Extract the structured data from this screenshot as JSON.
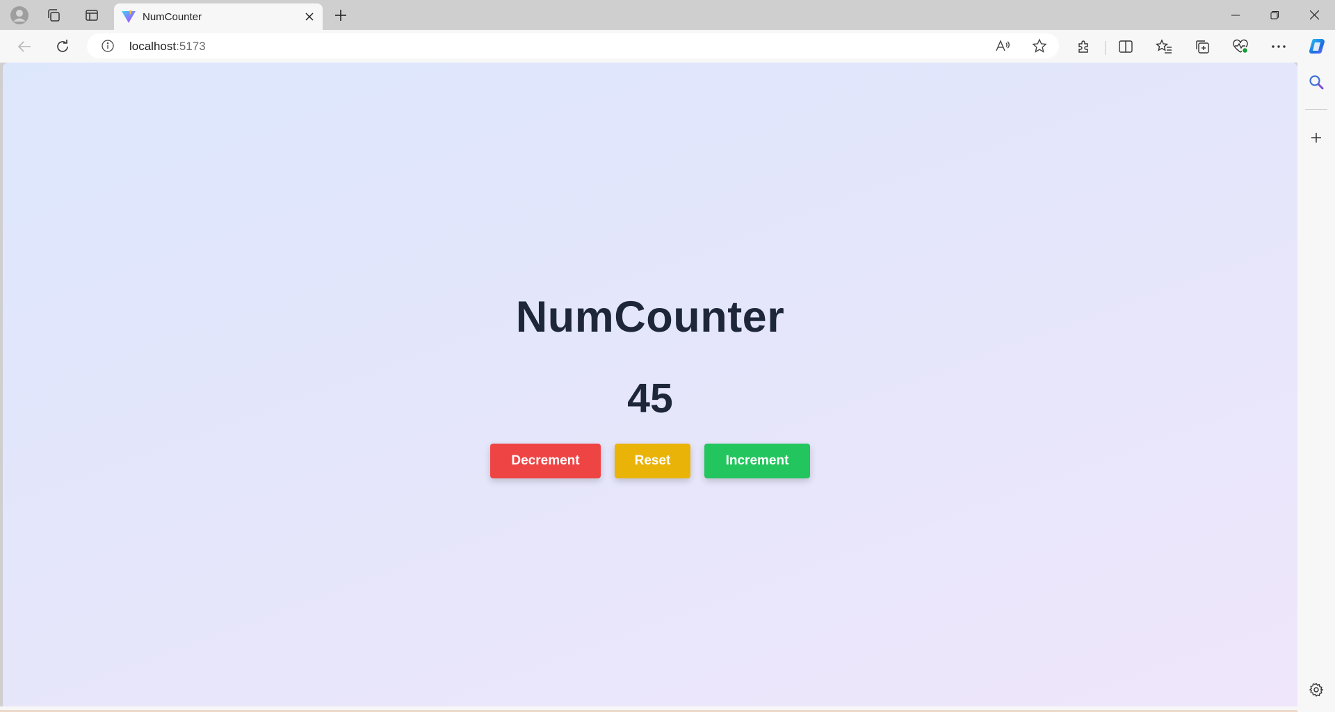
{
  "browser": {
    "tab": {
      "title": "NumCounter",
      "favicon": "vite-logo-icon"
    },
    "address": {
      "host": "localhost",
      "port": ":5173"
    },
    "icons": {
      "profile": "profile-avatar-icon",
      "workspaces": "workspaces-icon",
      "tab_actions": "vertical-tabs-icon",
      "back": "back-arrow-icon",
      "refresh": "refresh-icon",
      "site_info": "info-icon",
      "read_aloud": "read-aloud-icon",
      "favorite": "star-icon",
      "extensions": "extensions-puzzle-icon",
      "split_screen": "split-screen-icon",
      "favorites": "favorites-list-icon",
      "collections": "collections-icon",
      "browser_essentials": "heart-pulse-icon",
      "more": "more-dots-icon",
      "copilot": "copilot-icon",
      "sidebar_search": "search-icon",
      "sidebar_add": "plus-icon",
      "sidebar_settings": "gear-icon"
    }
  },
  "app": {
    "title": "NumCounter",
    "count": "45",
    "buttons": {
      "decrement": "Decrement",
      "reset": "Reset",
      "increment": "Increment"
    },
    "colors": {
      "decrement": "#ef4444",
      "reset": "#eab308",
      "increment": "#22c55e",
      "text": "#1e2739"
    }
  }
}
